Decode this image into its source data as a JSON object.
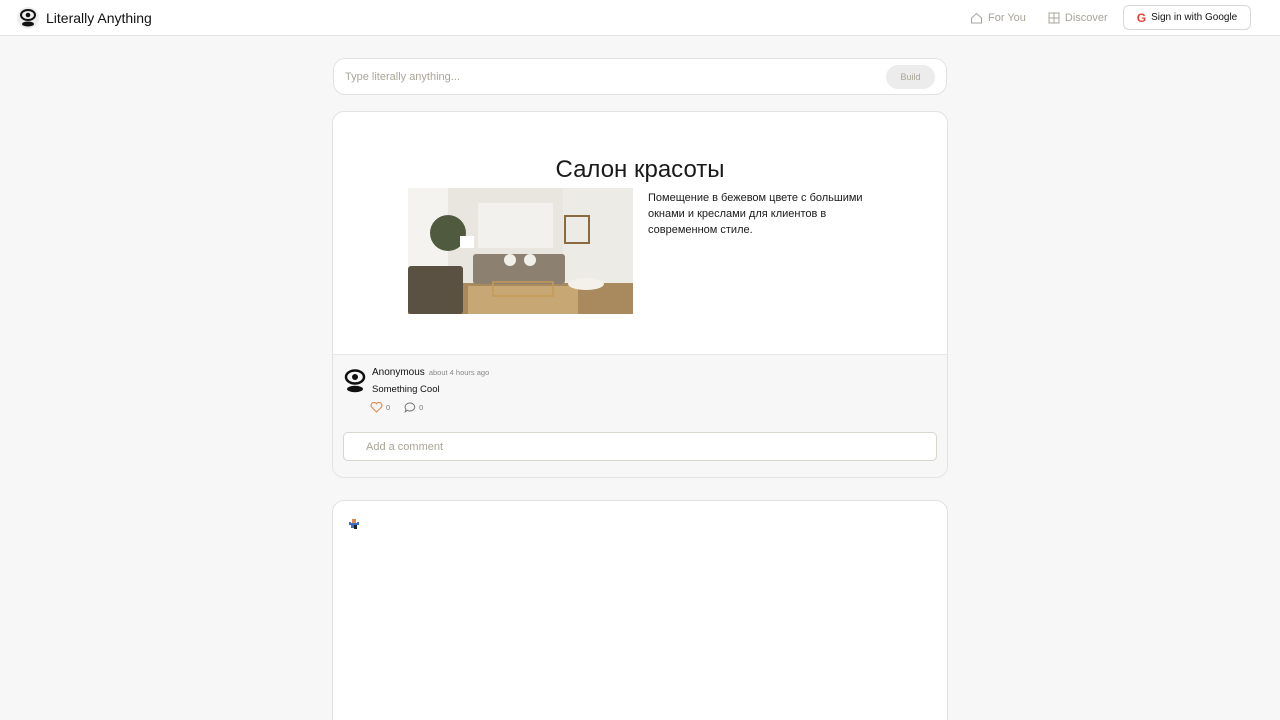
{
  "app": {
    "title": "Literally Anything",
    "logo_icon": "eye-icon"
  },
  "nav": {
    "items": [
      {
        "label": "For You",
        "icon": "home-icon"
      },
      {
        "label": "Discover",
        "icon": "grid-icon"
      }
    ],
    "signin_label": "Sign in with Google",
    "signin_icon": "google-icon"
  },
  "prompt": {
    "placeholder": "Type literally anything...",
    "value": "",
    "build_label": "Build"
  },
  "post": {
    "title": "Салон красоты",
    "image_alt": "Beige living room interior with sofa, armchairs and plants",
    "description": "Помещение в бежевом цвете с большими окнами и креслами для клиентов в современном стиле.",
    "author": "Anonymous",
    "timestamp": "about 4 hours ago",
    "text": "Something Cool",
    "likes": "0",
    "comments": "0",
    "comment_placeholder": "Add a comment"
  },
  "colors": {
    "accent_like": "#e08a4f",
    "muted_text": "#a9a597",
    "background": "#f7f7f7"
  }
}
